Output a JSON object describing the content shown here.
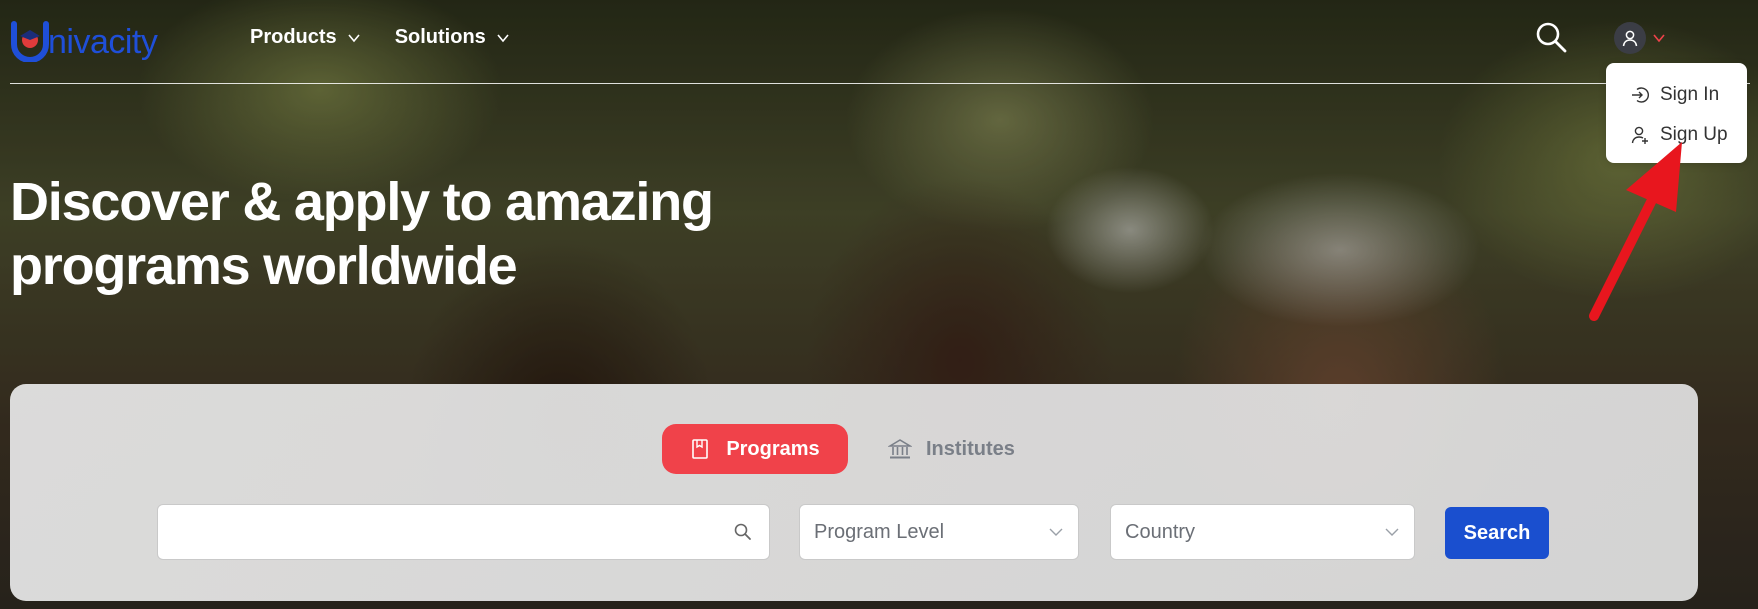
{
  "brand": {
    "logo_text": "nivacity",
    "logo_color": "#1f4fd8"
  },
  "nav": {
    "items": [
      {
        "label": "Products",
        "icon": "chevron-down-icon"
      },
      {
        "label": "Solutions",
        "icon": "chevron-down-icon"
      }
    ]
  },
  "header": {
    "search_icon": "search-icon",
    "avatar_icon": "user-icon",
    "avatar_chevron_color": "#f0424a"
  },
  "user_menu": {
    "items": [
      {
        "label": "Sign In",
        "icon": "sign-in-icon"
      },
      {
        "label": "Sign Up",
        "icon": "user-add-icon"
      }
    ]
  },
  "hero": {
    "title_line1": "Discover & apply to amazing",
    "title_line2": "programs worldwide"
  },
  "search_panel": {
    "tabs": [
      {
        "label": "Programs",
        "icon": "book-icon",
        "active": true
      },
      {
        "label": "Institutes",
        "icon": "institution-icon",
        "active": false
      }
    ],
    "keyword": {
      "value": "",
      "placeholder": ""
    },
    "program_level": {
      "placeholder": "Program Level"
    },
    "country": {
      "placeholder": "Country"
    },
    "search_label": "Search"
  },
  "colors": {
    "accent_red": "#f0424a",
    "primary_blue": "#1a4fcf",
    "annotation_arrow": "#e8161e"
  }
}
